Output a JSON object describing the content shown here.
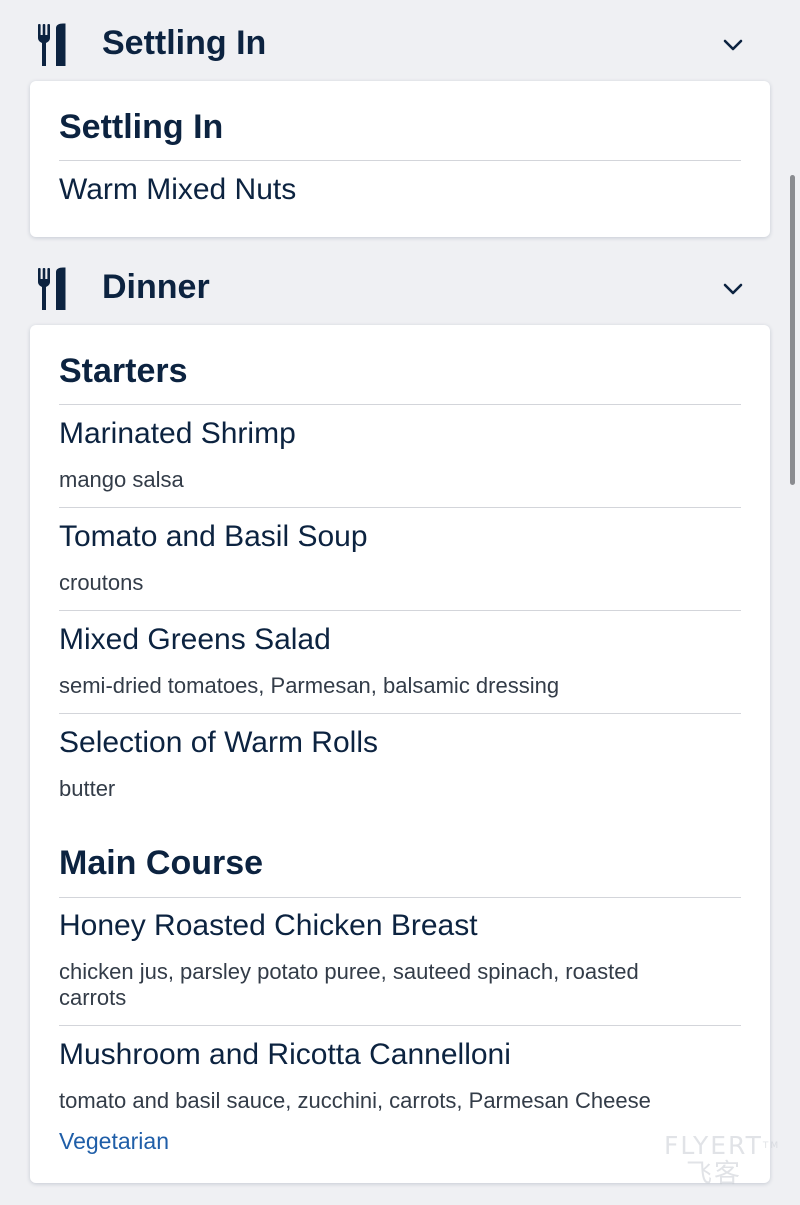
{
  "sections": [
    {
      "title": "Settling In",
      "icon": "fork-knife-icon",
      "chevron": "chevron-down-icon",
      "groups": [
        {
          "title": "Settling In",
          "items": [
            {
              "name": "Warm Mixed Nuts"
            }
          ]
        }
      ]
    },
    {
      "title": "Dinner",
      "icon": "fork-knife-icon",
      "chevron": "chevron-down-icon",
      "groups": [
        {
          "title": "Starters",
          "items": [
            {
              "name": "Marinated Shrimp",
              "description": "mango salsa"
            },
            {
              "name": "Tomato and Basil Soup",
              "description": "croutons"
            },
            {
              "name": "Mixed Greens Salad",
              "description": "semi-dried tomatoes, Parmesan, balsamic dressing"
            },
            {
              "name": "Selection of Warm Rolls",
              "description": "butter"
            }
          ]
        },
        {
          "title": "Main Course",
          "items": [
            {
              "name": "Honey Roasted Chicken Breast",
              "description_line1": "chicken jus, parsley potato puree, sauteed spinach, roasted",
              "description_line2": "carrots"
            },
            {
              "name": "Mushroom and Ricotta Cannelloni",
              "description": "tomato and basil sauce, zucchini, carrots, Parmesan Cheese",
              "tag": "Vegetarian"
            }
          ]
        }
      ]
    }
  ],
  "watermark": {
    "latin": "FLYERT",
    "tm": "TM",
    "cn": "飞客"
  },
  "colors": {
    "navy": "#0c2340",
    "link_blue": "#1f5ea8",
    "background": "#eff0f3",
    "card": "#ffffff",
    "divider": "#d3d5da"
  }
}
